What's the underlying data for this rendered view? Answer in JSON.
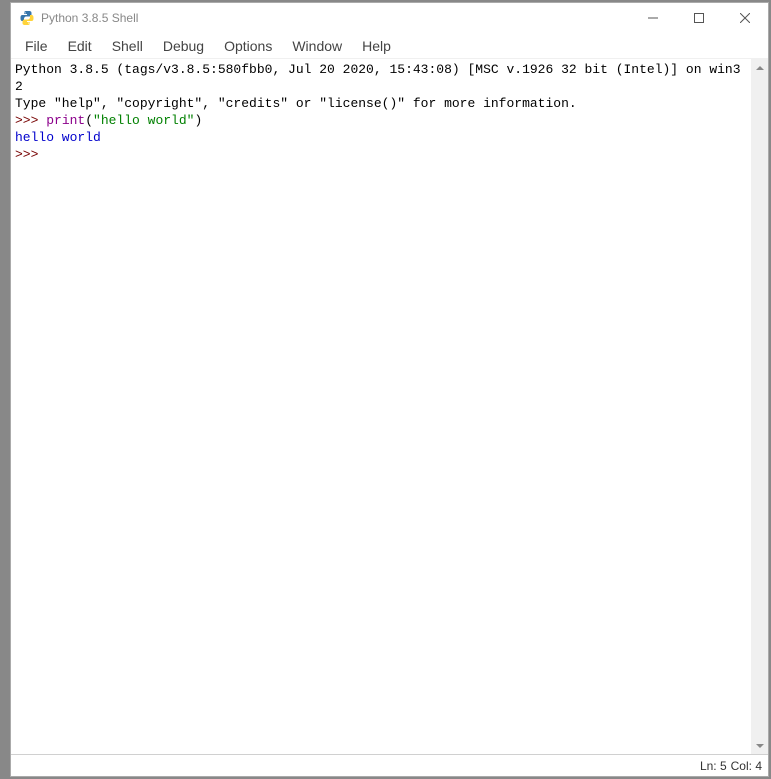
{
  "window": {
    "title": "Python 3.8.5 Shell"
  },
  "menubar": {
    "items": [
      "File",
      "Edit",
      "Shell",
      "Debug",
      "Options",
      "Window",
      "Help"
    ]
  },
  "shell": {
    "banner_line1": "Python 3.8.5 (tags/v3.8.5:580fbb0, Jul 20 2020, 15:43:08) [MSC v.1926 32 bit (Intel)] on win32",
    "banner_line2": "Type \"help\", \"copyright\", \"credits\" or \"license()\" for more information.",
    "prompt": ">>> ",
    "call_func": "print",
    "call_open": "(",
    "call_string": "\"hello world\"",
    "call_close": ")",
    "output": "hello world",
    "prompt2": ">>> "
  },
  "statusbar": {
    "ln_label": "Ln: 5",
    "col_label": "Col: 4"
  }
}
